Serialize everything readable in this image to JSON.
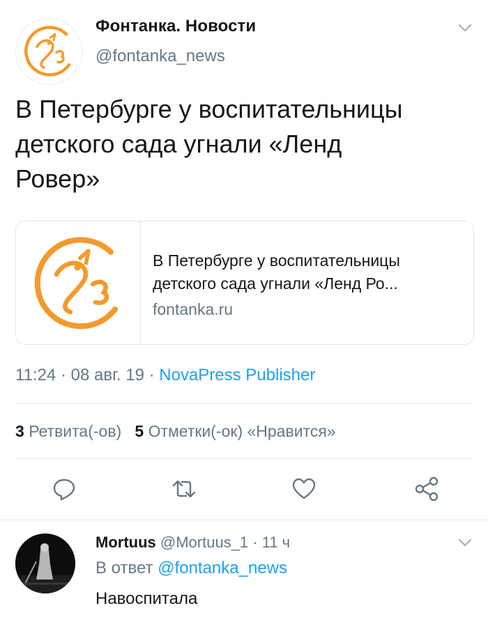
{
  "tweet": {
    "author_name": "Фонтанка. Новости",
    "author_handle": "@fontanka_news",
    "text_lines": [
      "В Петербурге у воспитательницы",
      "детского сада угнали «Ленд",
      "Ровер»"
    ],
    "card": {
      "title_lines": [
        "В Петербурге у воспитательницы",
        "детского сада угнали «Ленд Ро..."
      ],
      "domain": "fontanka.ru"
    },
    "time": "11:24",
    "dot1": " · ",
    "date": "08 авг. 19",
    "dot2": " · ",
    "source": "NovaPress Publisher",
    "retweets_count": "3",
    "retweets_label": "Ретвита(-ов)",
    "likes_count": "5",
    "likes_label": "Отметки(-ок) «Нравится»"
  },
  "actions": [
    "reply-icon",
    "retweet-icon",
    "like-icon",
    "share-icon"
  ],
  "reply": {
    "name": "Mortuus",
    "handle": "@Mortuus_1",
    "dot": " · ",
    "time": "11 ч",
    "reply_prefix": "В ответ ",
    "reply_to": "@fontanka_news",
    "text": "Навоспитала"
  },
  "colors": {
    "accent": "#1da1f2",
    "muted": "#657786",
    "brand_orange": "#f39a2b"
  }
}
